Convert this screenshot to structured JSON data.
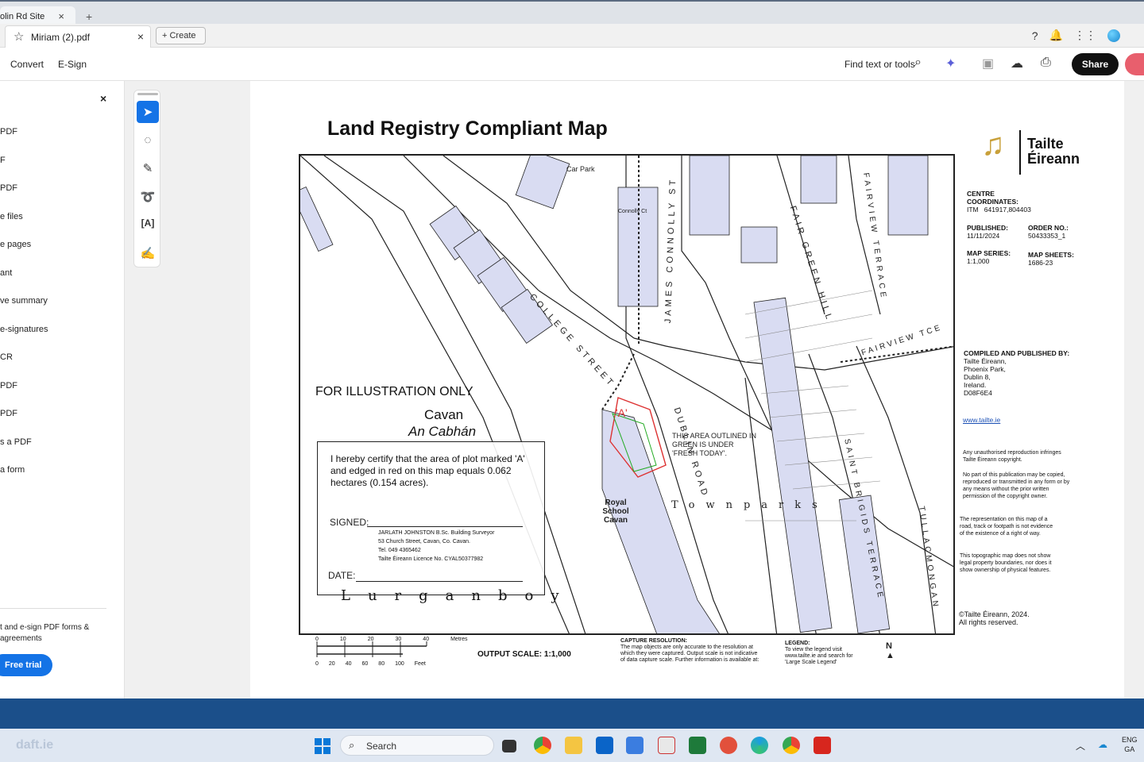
{
  "browser": {
    "tab_title": "olin Rd Site",
    "new_tab": "+"
  },
  "acrobat": {
    "doc_tab": "Miriam (2).pdf",
    "create": "Create",
    "menu": [
      "Convert",
      "E-Sign"
    ],
    "find": "Find text or tools",
    "share": "Share"
  },
  "left_panel": {
    "close": "×",
    "items": [
      "PDF",
      "F",
      "PDF",
      "e files",
      "e pages",
      "ant",
      "ve summary",
      "e-signatures",
      "CR",
      "PDF",
      "PDF",
      "s a PDF",
      "a form"
    ],
    "promo": "t and e-sign PDF forms & agreements",
    "trial": "Free trial"
  },
  "map": {
    "title": "Land Registry Compliant Map",
    "brand": [
      "Tailte",
      "Éireann"
    ],
    "centre_label": "CENTRE COORDINATES:",
    "itm": "ITM",
    "itm_value": "641917,804403",
    "published_label": "PUBLISHED:",
    "published_value": "11/11/2024",
    "order_label": "ORDER NO.:",
    "order_value": "50433353_1",
    "series_label": "MAP SERIES:",
    "series_value": "1:1,000",
    "sheets_label": "MAP SHEETS:",
    "sheets_value": "1686-23",
    "compiled_label": "COMPILED AND PUBLISHED BY:",
    "compiled_lines": [
      "Tailte Éireann,",
      "Phoenix Park,",
      "Dublin 8,",
      "Ireland.",
      "D08F6E4"
    ],
    "website": "www.tailte.ie",
    "copyright_note": "Any unauthorised reproduction infringes Tailte Éireann copyright.",
    "no_part": "No part of this publication may be copied, reproduced or transmitted in any form or by any means without the prior written permission of the copyright owner.",
    "representation": "The representation on this map of a road, track or footpath is not evidence of the existence of a right of way.",
    "topographic": "This topographic map does not show legal property boundaries, nor does it show ownership of physical features.",
    "copyright": "©Tailte Éireann, 2024.",
    "rights": "All rights reserved.",
    "illustration": "FOR ILLUSTRATION ONLY",
    "town": "Cavan",
    "town_irish": "An Cabhán",
    "cert_text": "I hereby certify that the area of plot marked 'A' and edged in red on this map equals 0.062 hectares (0.154 acres).",
    "signed": "SIGNED:",
    "surveyor_lines": [
      "JARLATH JOHNSTON B.Sc. Building Surveyor",
      "53 Church Street, Cavan, Co. Cavan.",
      "Tel. 049 4365462",
      "Tailte Éireann Licence No. CYAL50377982"
    ],
    "date": "DATE:",
    "townland_bottom": "Lurganboy",
    "townland_mid": "Townparks",
    "green_note": "THIS AREA OUTLINED IN GREEN IS UNDER 'FRESH TODAY'.",
    "plot_label": "'A'",
    "school": "Royal School Cavan",
    "streets": [
      "COLLEGE STREET",
      "JAMES CONNOLLY ST",
      "FAIR GREEN HILL",
      "FAIRVIEW TERRACE",
      "FAIRVIEW TCE",
      "DUBLIN ROAD",
      "SAINT BRIGIDS TERRACE",
      "TULLACMONGAN"
    ],
    "car_park": "Car Park",
    "connolly_ct": "Connolly Ct",
    "scale_metres": "Metres",
    "scale_feet": "Feet",
    "scale_m_ticks": [
      "0",
      "10",
      "20",
      "30",
      "40"
    ],
    "scale_ft_ticks": [
      "0",
      "20",
      "40",
      "60",
      "80",
      "100"
    ],
    "output_scale": "OUTPUT SCALE: 1:1,000",
    "capture_title": "CAPTURE RESOLUTION:",
    "capture_text": "The map objects are only accurate to the resolution at which they were captured. Output scale is not indicative of data capture scale. Further information is available at:",
    "legend_title": "LEGEND:",
    "legend_text": "To view the legend visit www.tailte.ie and search for 'Large Scale Legend'",
    "north": "N"
  },
  "taskbar": {
    "search": "Search",
    "lang1": "ENG",
    "lang2": "GA",
    "watermark": "daft.ie"
  }
}
